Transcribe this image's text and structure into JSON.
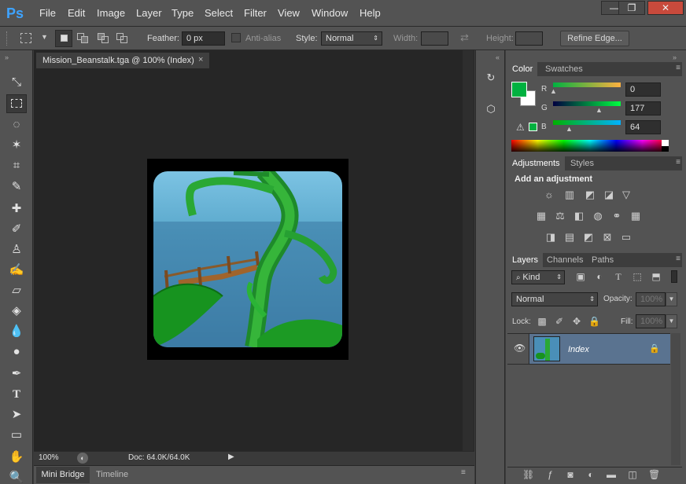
{
  "app": {
    "logo": "Ps"
  },
  "menu": [
    "File",
    "Edit",
    "Image",
    "Layer",
    "Type",
    "Select",
    "Filter",
    "View",
    "Window",
    "Help"
  ],
  "window_controls": {
    "minimize": "—",
    "restore": "❐",
    "close": "✕"
  },
  "options": {
    "feather_label": "Feather:",
    "feather_value": "0 px",
    "antialias_label": "Anti-alias",
    "style_label": "Style:",
    "style_value": "Normal",
    "width_label": "Width:",
    "height_label": "Height:",
    "refine_edge": "Refine Edge..."
  },
  "document": {
    "tab_title": "Mission_Beanstalk.tga @ 100% (Index)",
    "zoom": "100%",
    "doc_info": "Doc: 64.0K/64.0K"
  },
  "bottom_tabs": [
    "Mini Bridge",
    "Timeline"
  ],
  "color_panel": {
    "tabs": [
      "Color",
      "Swatches"
    ],
    "r_label": "R",
    "g_label": "G",
    "b_label": "B",
    "r_value": "0",
    "g_value": "177",
    "b_value": "64",
    "foreground": "#00b140"
  },
  "adjustments_panel": {
    "tabs": [
      "Adjustments",
      "Styles"
    ],
    "heading": "Add an adjustment"
  },
  "layers_panel": {
    "tabs": [
      "Layers",
      "Channels",
      "Paths"
    ],
    "kind_filter": "Kind",
    "blend_mode": "Normal",
    "opacity_label": "Opacity:",
    "opacity_value": "100%",
    "lock_label": "Lock:",
    "fill_label": "Fill:",
    "fill_value": "100%",
    "layers": [
      {
        "name": "Index"
      }
    ]
  },
  "colors": {
    "accent": "#3ea3ff",
    "selected_layer": "#5a7390",
    "close": "#c84a3c"
  }
}
